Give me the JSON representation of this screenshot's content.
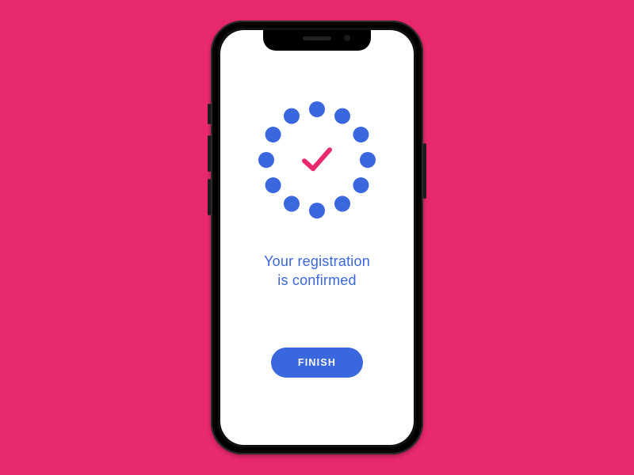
{
  "colors": {
    "background": "#e9296e",
    "accent": "#3a66de",
    "check": "#e9296e",
    "phone_body": "#111111",
    "screen": "#ffffff"
  },
  "confirmation": {
    "message_line1": "Your registration",
    "message_line2": "is confirmed"
  },
  "button": {
    "finish_label": "FINISH"
  },
  "icon_names": {
    "spinner": "progress-ring-icon",
    "check": "check-icon"
  }
}
